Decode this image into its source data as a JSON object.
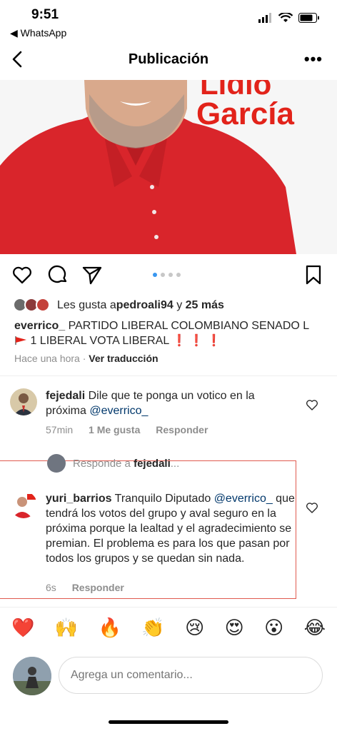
{
  "status": {
    "time": "9:51",
    "back_app": "◀ WhatsApp"
  },
  "header": {
    "title": "Publicación",
    "more": "•••"
  },
  "image_text": {
    "line1": "Lidio",
    "line2": "García"
  },
  "likes": {
    "prefix": "Les gusta a ",
    "user": "pedroali94",
    "middle": " y ",
    "rest": "25 más"
  },
  "caption": {
    "user": "everrico_",
    "text1": " PARTIDO LIBERAL COLOMBIANO SENADO L",
    "text2": "1 LIBERAL VOTA LIBERAL ",
    "marks": "❗ ❗ ❗"
  },
  "post_meta": {
    "time": "Hace una hora",
    "sep": " · ",
    "translate": "Ver traducción"
  },
  "comment1": {
    "user": "fejedali",
    "text": " Dile que te ponga un votico en la próxima ",
    "mention": "@everrico_",
    "time": "57min",
    "likes": "1 Me gusta",
    "reply": "Responder"
  },
  "reply_to": {
    "prefix": "Responde a ",
    "user": "fejedali",
    "suffix": "..."
  },
  "comment2": {
    "user": "yuri_barrios",
    "text1": " Tranquilo Diputado ",
    "mention": "@everrico_",
    "text2": " que tendrá los votos del grupo y aval seguro en la próxima porque la lealtad y el agradecimiento se premian. El problema es para los que pasan por todos los grupos y se quedan sin nada.",
    "time": "6s",
    "reply": "Responder"
  },
  "emojis": [
    "❤️",
    "🙌",
    "🔥",
    "👏",
    "😢",
    "😍",
    "😮",
    "😂"
  ],
  "composer": {
    "placeholder": "Agrega un comentario..."
  },
  "colors": {
    "accent_red": "#e2231a",
    "link": "#00376b",
    "muted": "#8e8e8e",
    "highlight_border": "#e05a4f"
  }
}
